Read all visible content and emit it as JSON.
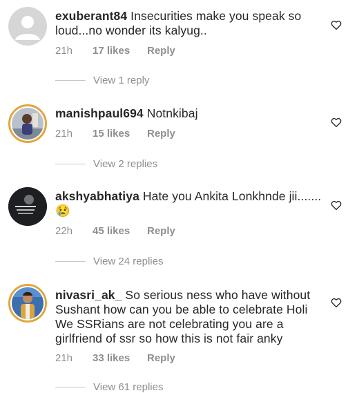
{
  "comments": [
    {
      "username": "exuberant84",
      "text": "Insecurities make you speak so loud...no wonder its kalyug..",
      "time": "21h",
      "likes": "17 likes",
      "reply_label": "Reply",
      "view_replies": "View 1 reply",
      "avatar": "default-avatar-icon"
    },
    {
      "username": "manishpaul694",
      "text": "Notnkibaj",
      "time": "21h",
      "likes": "15 likes",
      "reply_label": "Reply",
      "view_replies": "View 2 replies",
      "avatar": "profile-photo"
    },
    {
      "username": "akshyabhatiya",
      "text": "Hate you Ankita Lonkhnde jii.......",
      "emoji": "😢",
      "time": "22h",
      "likes": "45 likes",
      "reply_label": "Reply",
      "view_replies": "View 24 replies",
      "avatar": "profile-photo"
    },
    {
      "username": "nivasri_ak_",
      "text": "So serious ness who have without Sushant how can you be able to celebrate Holi We SSRians are not celebrating you are a girlfriend of ssr so how this is not fair anky",
      "time": "21h",
      "likes": "33 likes",
      "reply_label": "Reply",
      "view_replies": "View 61 replies",
      "avatar": "profile-photo"
    }
  ],
  "colors": {
    "text": "#262626",
    "meta": "#8e8e8e",
    "ring": "#e1a63d"
  },
  "icons": {
    "like": "heart-outline-icon"
  }
}
